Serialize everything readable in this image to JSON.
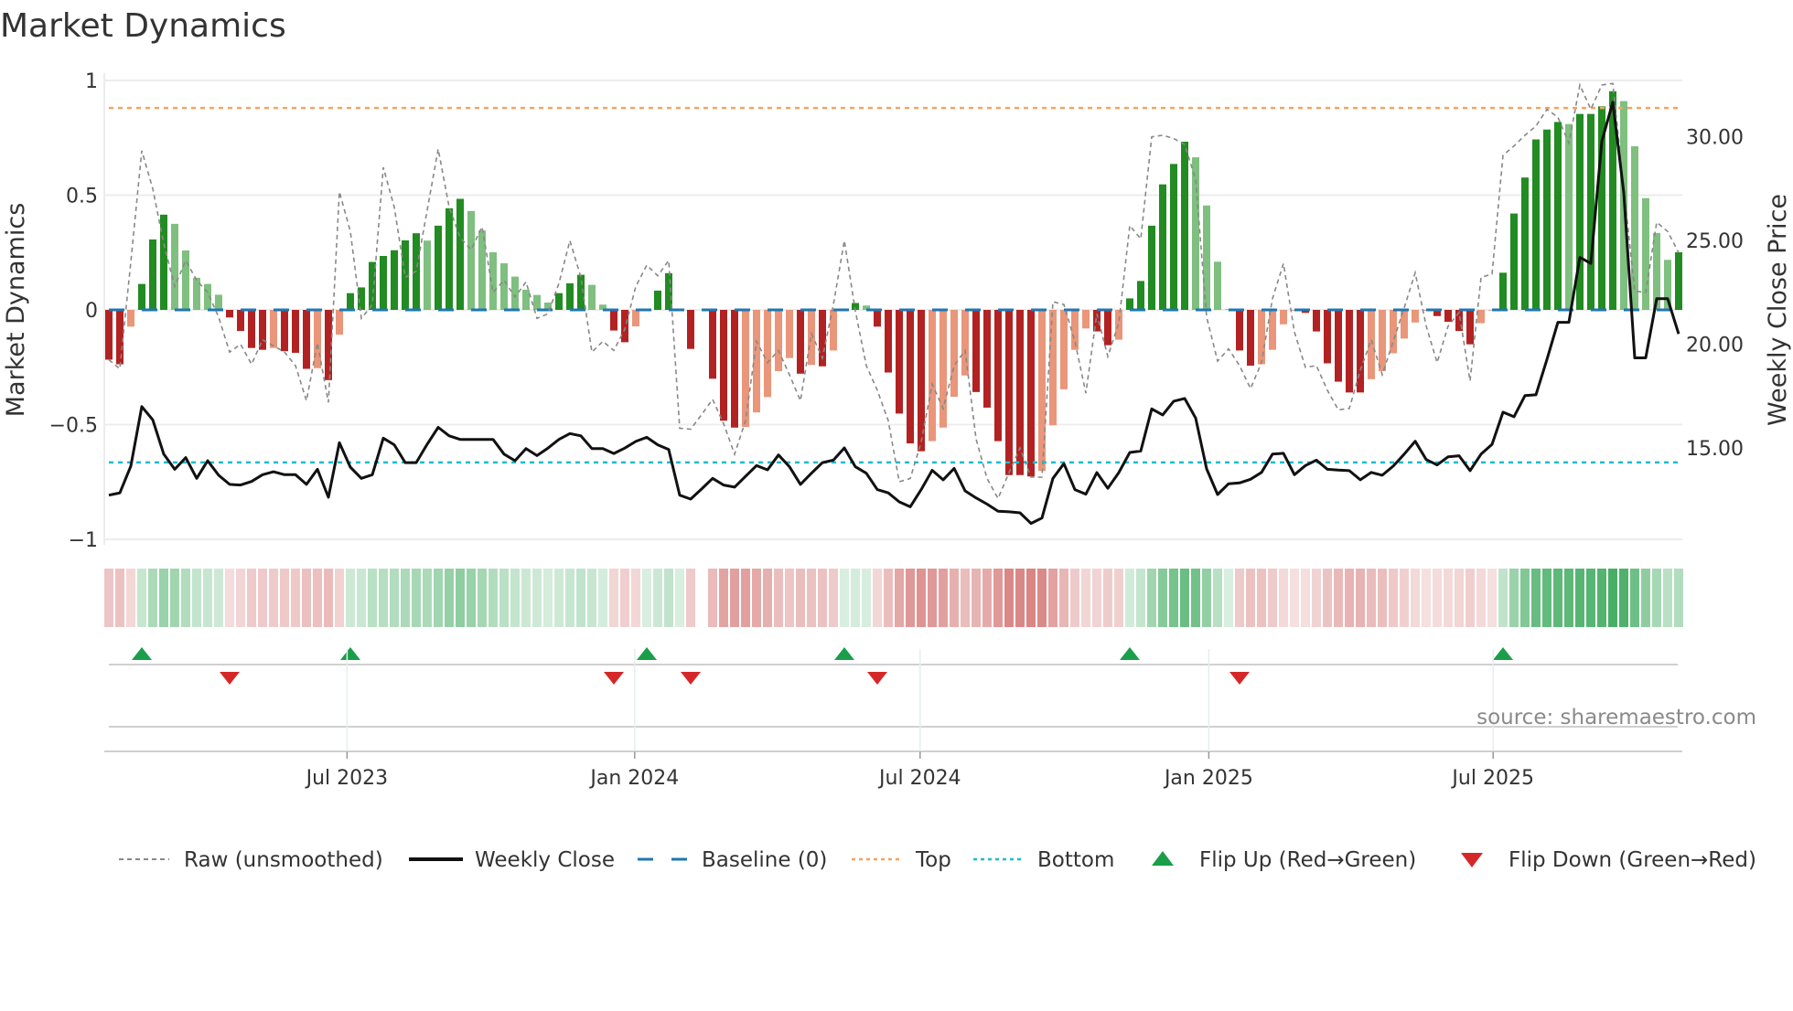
{
  "chart_data": {
    "type": "bar",
    "title": "Market Dynamics",
    "ylabel": "Market Dynamics",
    "y2label": "Weekly Close Price",
    "ylim": [
      -1,
      1
    ],
    "y2lim": [
      10.1,
      32.2
    ],
    "yticks": [
      {
        "v": 1,
        "label": "1"
      },
      {
        "v": 0.5,
        "label": "0.5"
      },
      {
        "v": 0,
        "label": "0"
      },
      {
        "v": -0.5,
        "label": "−0.5"
      },
      {
        "v": -1,
        "label": "−1"
      }
    ],
    "y2ticks": [
      {
        "v": 30,
        "label": "30.00"
      },
      {
        "v": 25,
        "label": "25.00"
      },
      {
        "v": 20,
        "label": "20.00"
      },
      {
        "v": 15,
        "label": "15.00"
      }
    ],
    "xticks": [
      {
        "week": 21.7,
        "label": "Jul 2023"
      },
      {
        "week": 47.9,
        "label": "Jan 2024"
      },
      {
        "week": 73.9,
        "label": "Jul 2024"
      },
      {
        "week": 100.2,
        "label": "Jan 2025"
      },
      {
        "week": 126.1,
        "label": "Jul 2025"
      }
    ],
    "top_level": 0.88,
    "bottom_level": -0.665,
    "baseline": 0,
    "market_dynamics": [
      -0.217,
      -0.237,
      -0.073,
      0.113,
      0.307,
      0.415,
      0.375,
      0.259,
      0.14,
      0.113,
      0.066,
      -0.033,
      -0.092,
      -0.166,
      -0.174,
      -0.166,
      -0.18,
      -0.187,
      -0.257,
      -0.254,
      -0.306,
      -0.108,
      0.073,
      0.098,
      0.209,
      0.235,
      0.26,
      0.303,
      0.334,
      0.302,
      0.367,
      0.443,
      0.484,
      0.431,
      0.346,
      0.251,
      0.203,
      0.145,
      0.088,
      0.065,
      0.032,
      0.073,
      0.116,
      0.153,
      0.109,
      0.023,
      -0.09,
      -0.141,
      -0.072,
      0.004,
      0.084,
      0.16,
      0.005,
      -0.17,
      0,
      -0.3,
      -0.483,
      -0.513,
      -0.51,
      -0.447,
      -0.38,
      -0.267,
      -0.21,
      -0.278,
      -0.24,
      -0.246,
      -0.177,
      0.004,
      0.03,
      0.019,
      -0.073,
      -0.273,
      -0.452,
      -0.582,
      -0.616,
      -0.572,
      -0.513,
      -0.379,
      -0.286,
      -0.358,
      -0.426,
      -0.572,
      -0.72,
      -0.72,
      -0.726,
      -0.702,
      -0.503,
      -0.346,
      -0.174,
      -0.081,
      -0.094,
      -0.154,
      -0.13,
      0.05,
      0.126,
      0.367,
      0.547,
      0.636,
      0.733,
      0.665,
      0.455,
      0.21,
      0.003,
      -0.177,
      -0.243,
      -0.237,
      -0.174,
      -0.063,
      -0.004,
      -0.013,
      -0.094,
      -0.233,
      -0.313,
      -0.36,
      -0.36,
      -0.302,
      -0.267,
      -0.189,
      -0.125,
      -0.055,
      -0.004,
      -0.027,
      -0.052,
      -0.092,
      -0.15,
      -0.058,
      -0.003,
      0.162,
      0.42,
      0.577,
      0.743,
      0.786,
      0.819,
      0.81,
      0.854,
      0.854,
      0.887,
      0.953,
      0.91,
      0.713,
      0.487,
      0.335,
      0.218,
      0.251
    ],
    "raw": [
      -0.217,
      -0.257,
      0.209,
      0.694,
      0.528,
      0.289,
      0.102,
      0.215,
      0.129,
      0.076,
      -0.031,
      -0.184,
      -0.15,
      -0.237,
      -0.13,
      -0.157,
      -0.184,
      -0.243,
      -0.396,
      -0.144,
      -0.403,
      0.515,
      0.342,
      -0.037,
      0.023,
      0.621,
      0.448,
      0.142,
      0.169,
      0.435,
      0.701,
      0.448,
      0.315,
      0.262,
      0.362,
      0.076,
      0.129,
      0.056,
      0.122,
      -0.037,
      -0.017,
      0.116,
      0.302,
      0.142,
      -0.184,
      -0.137,
      -0.177,
      -0.084,
      0.102,
      0.195,
      0.149,
      0.215,
      -0.516,
      -0.52,
      -0.456,
      -0.39,
      -0.496,
      -0.629,
      -0.483,
      -0.137,
      -0.23,
      -0.177,
      -0.283,
      -0.396,
      -0.104,
      -0.21,
      0.023,
      0.302,
      -0.004,
      -0.243,
      -0.35,
      -0.483,
      -0.749,
      -0.735,
      -0.576,
      -0.323,
      -0.43,
      -0.243,
      -0.177,
      -0.563,
      -0.735,
      -0.822,
      -0.709,
      -0.602,
      -0.729,
      -0.729,
      0.036,
      0.023,
      -0.137,
      -0.363,
      -0.017,
      -0.203,
      -0.057,
      0.368,
      0.309,
      0.754,
      0.761,
      0.747,
      0.721,
      0.568,
      -0.031,
      -0.223,
      -0.17,
      -0.243,
      -0.343,
      -0.23,
      0.049,
      0.202,
      -0.097,
      -0.25,
      -0.243,
      -0.35,
      -0.436,
      -0.43,
      -0.263,
      -0.13,
      -0.283,
      -0.137,
      0.009,
      0.162,
      -0.07,
      -0.23,
      -0.07,
      -0.011,
      -0.31,
      0.142,
      0.156,
      0.674,
      0.714,
      0.761,
      0.801,
      0.874,
      0.84,
      0.727,
      0.98,
      0.874,
      0.98,
      0.987,
      0.528,
      0.082,
      0.076,
      0.382,
      0.342,
      0.249
    ],
    "weekly_close": [
      12.73,
      12.84,
      14.13,
      17.0,
      16.36,
      14.71,
      13.98,
      14.54,
      13.54,
      14.39,
      13.69,
      13.25,
      13.22,
      13.39,
      13.72,
      13.86,
      13.72,
      13.72,
      13.25,
      13.98,
      12.63,
      15.26,
      14.08,
      13.54,
      13.72,
      15.48,
      15.16,
      14.3,
      14.3,
      15.19,
      16.0,
      15.59,
      15.42,
      15.42,
      15.42,
      15.42,
      14.71,
      14.39,
      14.98,
      14.64,
      15.0,
      15.42,
      15.7,
      15.59,
      14.98,
      14.98,
      14.74,
      15.0,
      15.32,
      15.52,
      15.16,
      14.93,
      12.73,
      12.54,
      13.03,
      13.54,
      13.22,
      13.12,
      13.64,
      14.16,
      13.95,
      14.67,
      14.1,
      13.25,
      13.79,
      14.3,
      14.42,
      15.01,
      14.1,
      13.79,
      13.0,
      12.84,
      12.41,
      12.17,
      13.0,
      13.93,
      13.47,
      14.02,
      12.94,
      12.6,
      12.3,
      11.96,
      11.93,
      11.88,
      11.37,
      11.63,
      13.54,
      14.25,
      13.0,
      12.78,
      13.82,
      13.06,
      13.82,
      14.79,
      14.86,
      16.89,
      16.6,
      17.26,
      17.39,
      16.45,
      14.0,
      12.76,
      13.28,
      13.32,
      13.5,
      13.83,
      14.71,
      14.75,
      13.72,
      14.16,
      14.42,
      13.98,
      13.94,
      13.91,
      13.47,
      13.83,
      13.69,
      14.13,
      14.71,
      15.33,
      14.45,
      14.19,
      14.58,
      14.63,
      13.91,
      14.71,
      15.18,
      16.73,
      16.51,
      17.53,
      17.57,
      19.27,
      21.06,
      21.06,
      24.19,
      23.9,
      29.78,
      31.67,
      27.31,
      19.35,
      19.35,
      22.2,
      22.2,
      20.5
    ],
    "flip_up_weeks": [
      3,
      22,
      49,
      67,
      93,
      127
    ],
    "flip_down_weeks": [
      11,
      46,
      53,
      70,
      103
    ],
    "colors": {
      "rising_positive": "#228b22",
      "falling_positive": "#7fbf7f",
      "falling_negative": "#b22222",
      "rising_negative": "#e9967a",
      "raw": "#888888",
      "close": "#111111",
      "baseline": "#1f77b4",
      "top": "#f4a460",
      "bottom": "#17becf",
      "flip_up": "#1a9e4a",
      "flip_down": "#d62728"
    },
    "legend": {
      "placement": "bottom",
      "raw": "Raw (unsmoothed)",
      "close": "Weekly Close",
      "baseline": "Baseline (0)",
      "top": "Top",
      "bottom": "Bottom",
      "flip_up": "Flip Up (Red→Green)",
      "flip_down": "Flip Down (Green→Red)"
    },
    "source": "source: sharemaestro.com",
    "grid": true
  }
}
